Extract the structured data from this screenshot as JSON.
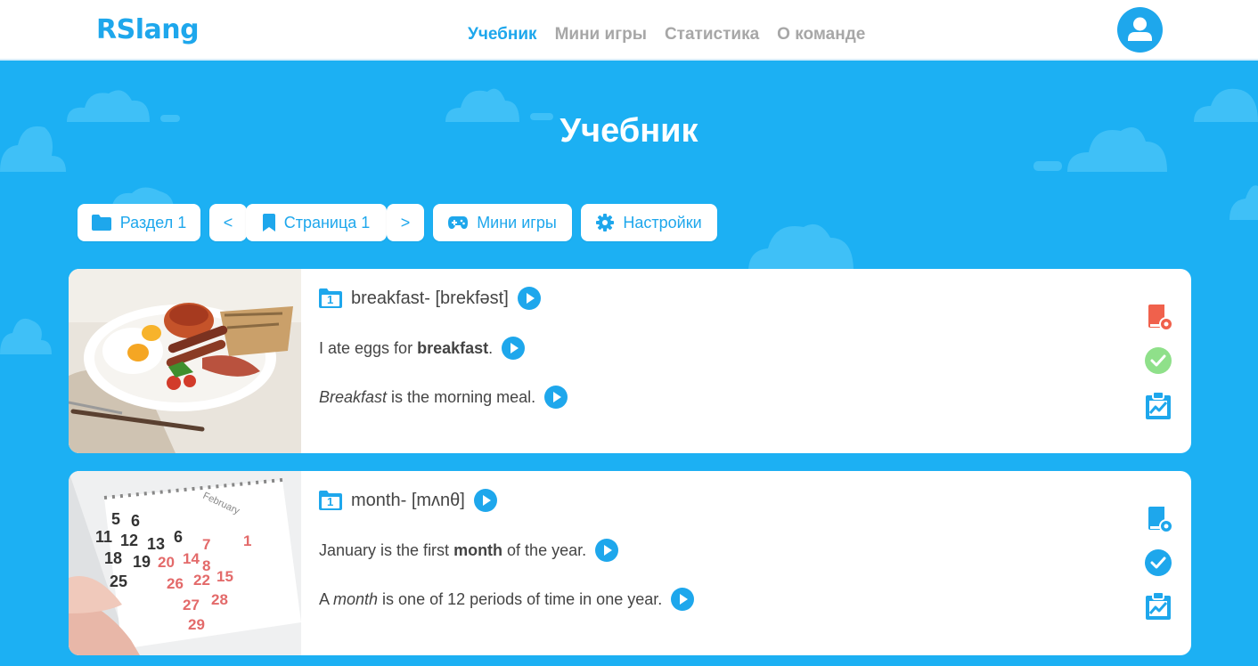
{
  "header": {
    "logo": "RSlang",
    "nav": [
      "Учебник",
      "Мини игры",
      "Статистика",
      "О команде"
    ],
    "active_index": 0
  },
  "page": {
    "title": "Учебник"
  },
  "toolbar": {
    "section": "Раздел 1",
    "prev": "<",
    "page": "Страница 1",
    "next": ">",
    "games": "Мини игры",
    "settings": "Настройки"
  },
  "cards": [
    {
      "group": "1",
      "word": "breakfast",
      "transcription": "[brekfəst]",
      "sep": "-",
      "example_pre": "I ate eggs for ",
      "example_word": "breakfast",
      "example_post": ".",
      "meaning_pre": "",
      "meaning_word": "Breakfast",
      "meaning_post": " is the morning meal.",
      "difficult": true,
      "learned": false,
      "image_icon": "breakfast-photo"
    },
    {
      "group": "1",
      "word": "month",
      "transcription": "[mʌnθ]",
      "sep": "-",
      "example_pre": "January is the first ",
      "example_word": "month",
      "example_post": " of the year.",
      "meaning_pre": "A ",
      "meaning_word": "month",
      "meaning_post": " is one of 12 periods of time in one year.",
      "difficult": false,
      "learned": true,
      "image_icon": "calendar-photo"
    }
  ],
  "colors": {
    "accent": "#1ea7ec",
    "background": "#1cb0f3",
    "difficult": "#f0614c",
    "learned_light": "#8fe08a",
    "nav_inactive": "#a7a7a7"
  }
}
